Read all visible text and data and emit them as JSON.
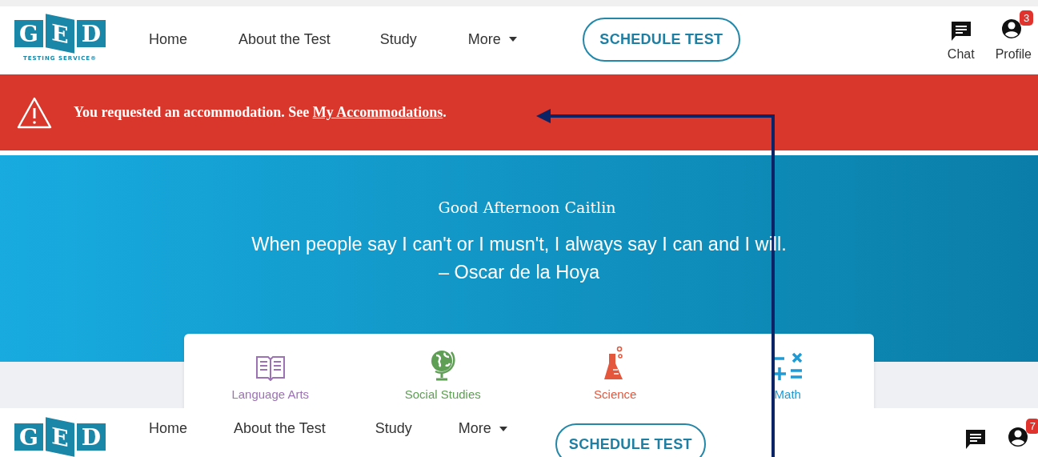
{
  "screens": [
    {
      "header": {
        "logo": {
          "letters": [
            "G",
            "E",
            "D"
          ],
          "tagline": "TESTING SERVICE®"
        },
        "nav": [
          {
            "label": "Home",
            "dropdown": false
          },
          {
            "label": "About the Test",
            "dropdown": false
          },
          {
            "label": "Study",
            "dropdown": false
          },
          {
            "label": "More",
            "dropdown": true
          }
        ],
        "cta": "SCHEDULE TEST",
        "actions": [
          {
            "kind": "chat",
            "label": "Chat"
          },
          {
            "kind": "profile",
            "label": "Profile",
            "badge": "3"
          }
        ]
      },
      "alert": {
        "text": "You requested an accommodation. See ",
        "link": "My Accommodations",
        "end": "."
      },
      "hero": {
        "greeting": "Good Afternoon Caitlin",
        "quote": "When people say I can't or I musn't, I always say I can and I will.",
        "author": "– Oscar de la Hoya"
      },
      "subjects": [
        {
          "kind": "book",
          "label": "Language Arts",
          "color": "#9c72b4"
        },
        {
          "kind": "globe",
          "label": "Social Studies",
          "color": "#5f9e55"
        },
        {
          "kind": "flask",
          "label": "Science",
          "color": "#e4573d"
        },
        {
          "kind": "math",
          "label": "Math",
          "color": "#1f9ad4"
        }
      ]
    },
    {
      "header": {
        "logo": {
          "letters": [
            "G",
            "E",
            "D"
          ]
        },
        "nav": [
          {
            "label": "Home",
            "dropdown": false
          },
          {
            "label": "About the Test",
            "dropdown": false
          },
          {
            "label": "Study",
            "dropdown": false
          },
          {
            "label": "More",
            "dropdown": true
          }
        ],
        "cta": "SCHEDULE TEST",
        "actions": [
          {
            "kind": "chat"
          },
          {
            "kind": "profile",
            "badge": "7"
          }
        ]
      }
    }
  ]
}
